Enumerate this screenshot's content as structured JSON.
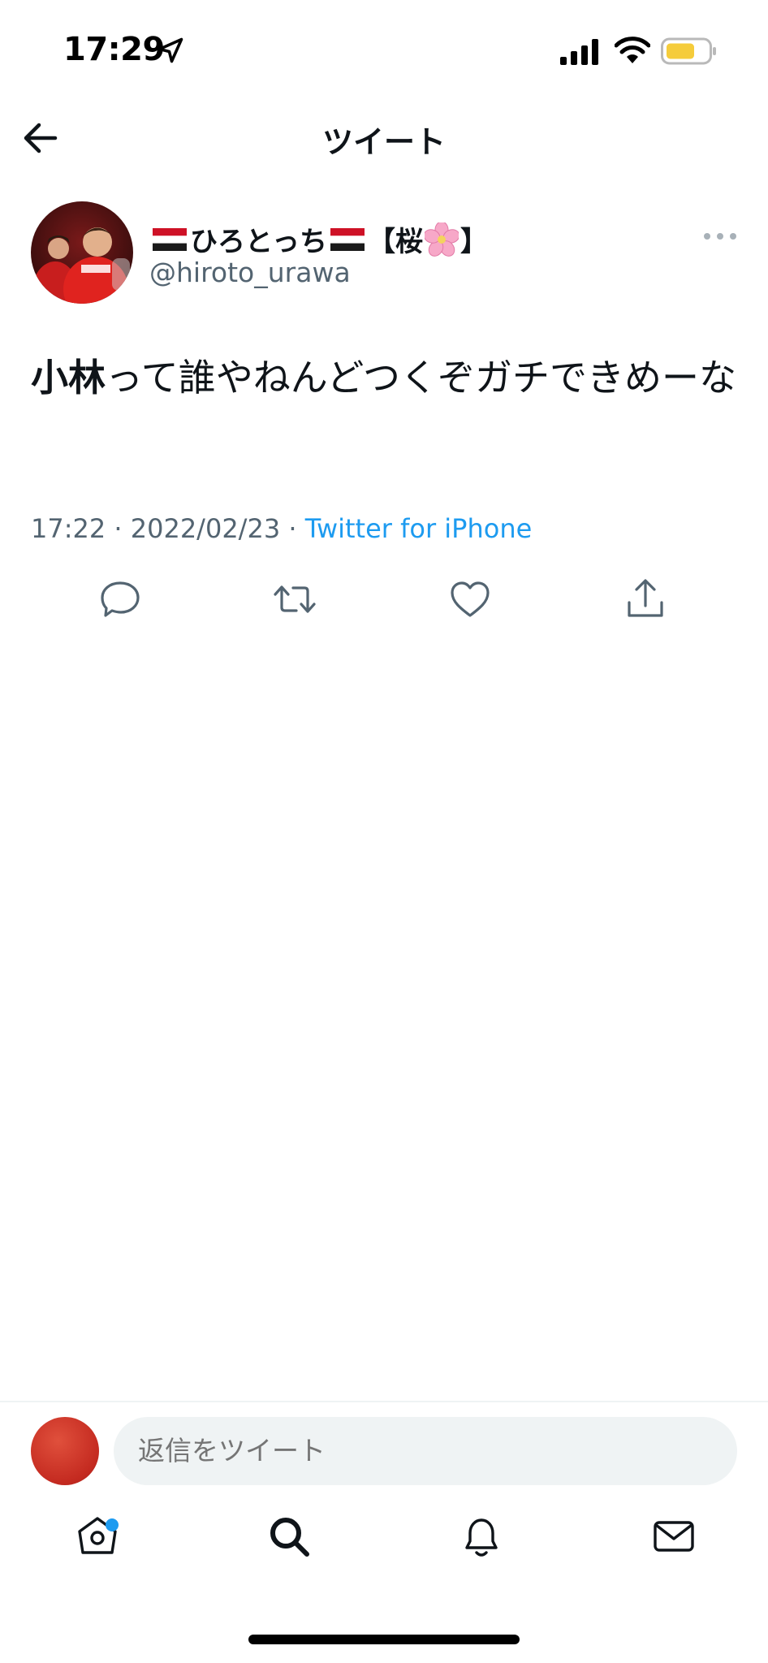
{
  "status_bar": {
    "time": "17:29",
    "battery_color": "#f5cc3b"
  },
  "nav": {
    "title": "ツイート"
  },
  "tweet": {
    "display_name_text": "ひろとっち",
    "display_name_bracket_open": "【桜",
    "display_name_bracket_close": "】",
    "handle": "@hiroto_urawa",
    "text_bold": "小林",
    "text_rest": "って誰やねんどつくぞガチできめーな",
    "timestamp": "17:22 · 2022/02/23 · ",
    "source": "Twitter for iPhone"
  },
  "actions": {
    "icons": [
      "reply-icon",
      "retweet-icon",
      "like-icon",
      "share-icon"
    ]
  },
  "reply_bar": {
    "placeholder": "返信をツイート"
  },
  "tab_bar": {
    "icons": [
      "home-icon",
      "search-icon",
      "notifications-icon",
      "messages-icon"
    ],
    "notification_dot_color": "#1d9bf0"
  },
  "colors": {
    "accent": "#1d9bf0",
    "secondary_text": "#536471",
    "primary_text": "#0f1419"
  }
}
